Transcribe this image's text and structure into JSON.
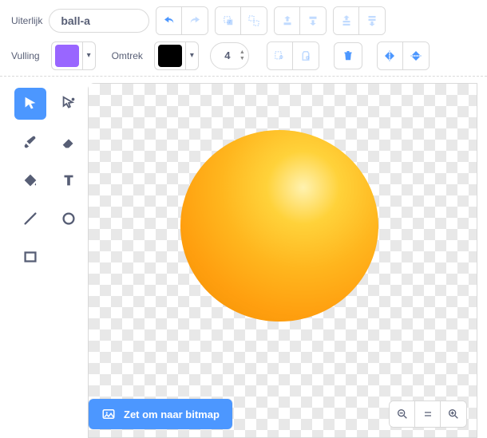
{
  "labels": {
    "costume": "Uiterlijk",
    "fill": "Vulling",
    "outline": "Omtrek"
  },
  "costume_name": "ball-a",
  "outline_width": "4",
  "colors": {
    "fill": "#9966ff",
    "outline": "#000000"
  },
  "bitmap_button": "Zet om naar bitmap"
}
